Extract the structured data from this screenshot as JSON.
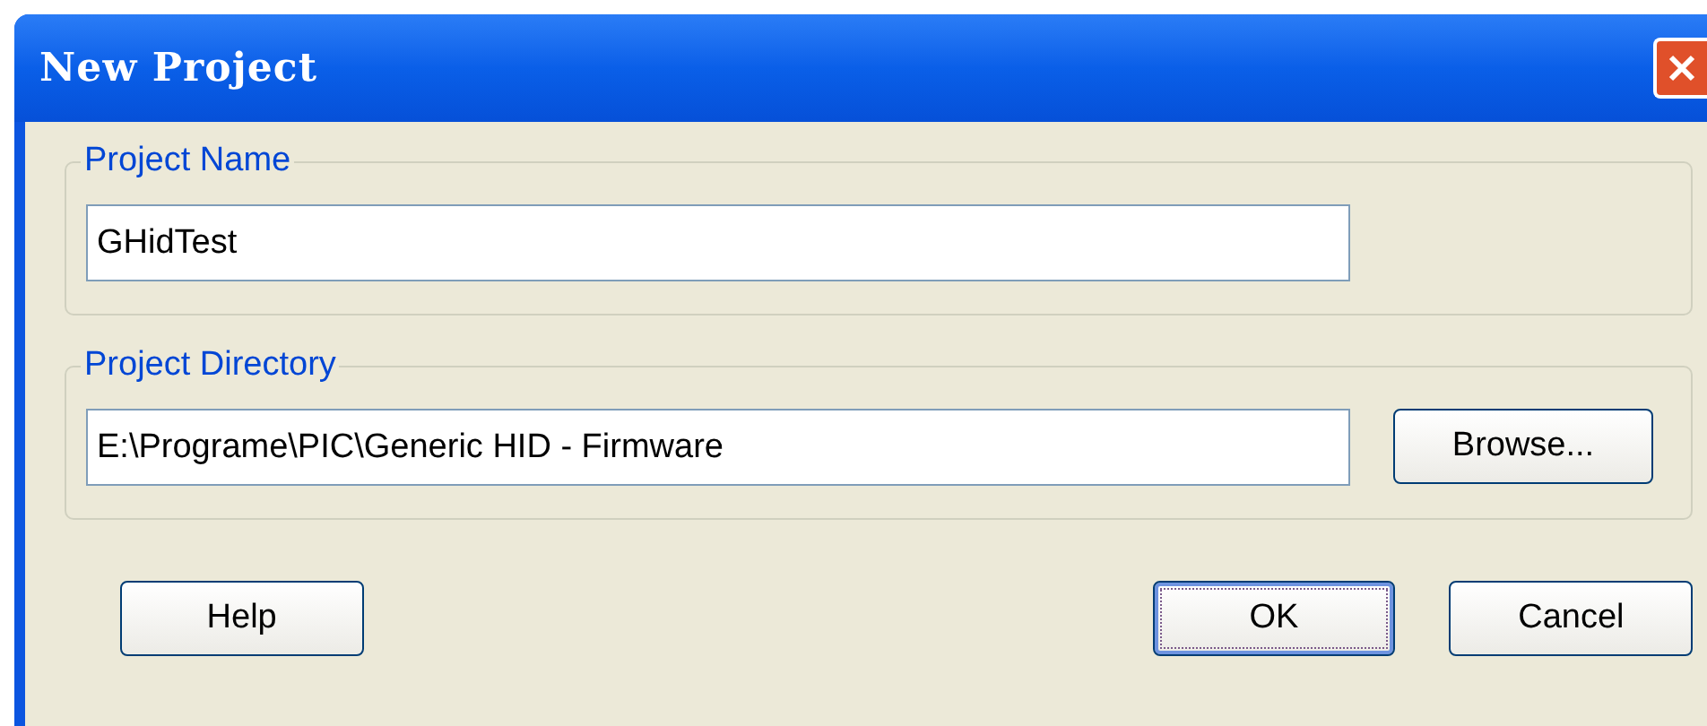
{
  "window": {
    "title": "New Project"
  },
  "groups": [
    {
      "legend": "Project Name",
      "value": "GHidTest"
    },
    {
      "legend": "Project Directory",
      "value": "E:\\Programe\\PIC\\Generic HID - Firmware",
      "button": "Browse..."
    }
  ],
  "buttons": [
    {
      "label": "Help",
      "focused": false
    },
    {
      "label": "OK",
      "focused": true
    },
    {
      "label": "Cancel",
      "focused": false
    }
  ]
}
